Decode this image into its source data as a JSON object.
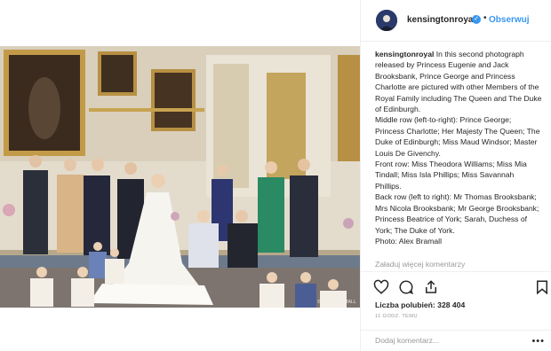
{
  "post": {
    "username": "kensingtonroyal",
    "follow_label": "Obserwuj",
    "separator": "•",
    "verified_mark": "✓",
    "photo_watermark": "©ALEX BRAMALL",
    "caption_user": "kensingtonroyal",
    "caption_text": "In this second photograph released by Princess Eugenie and Jack Brooksbank, Prince George and Princess Charlotte are pictured with other Members of the Royal Family including The Queen and The Duke of Edinburgh.",
    "caption_lines": [
      "Middle row (left-to-right): Prince George; Princess Charlotte; Her Majesty The Queen; The Duke of Edinburgh; Miss Maud Windsor; Master Louis De Givenchy.",
      "Front row: Miss Theodora Williams; Miss Mia Tindall; Miss Isla Phillips; Miss Savannah Phillips.",
      "Back row (left to right): Mr Thomas Brooksbank; Mrs Nicola Brooksbank; Mr George Brooksbank; Princess Beatrice of York; Sarah, Duchess of York; The Duke of York.",
      "Photo: Alex Bramall"
    ],
    "load_more": "Załaduj więcej komentarzy",
    "likes": "Liczba polubień: 328 404",
    "time": "11 GODZ. TEMU",
    "comment_placeholder": "Dodaj komentarz...",
    "more_label": "•••"
  },
  "icons": [
    "heart-icon",
    "comment-icon",
    "share-icon",
    "bookmark-icon",
    "verified-icon"
  ],
  "colors": {
    "link": "#3897f0",
    "muted": "#999999",
    "text": "#262626",
    "border": "#efefef"
  }
}
